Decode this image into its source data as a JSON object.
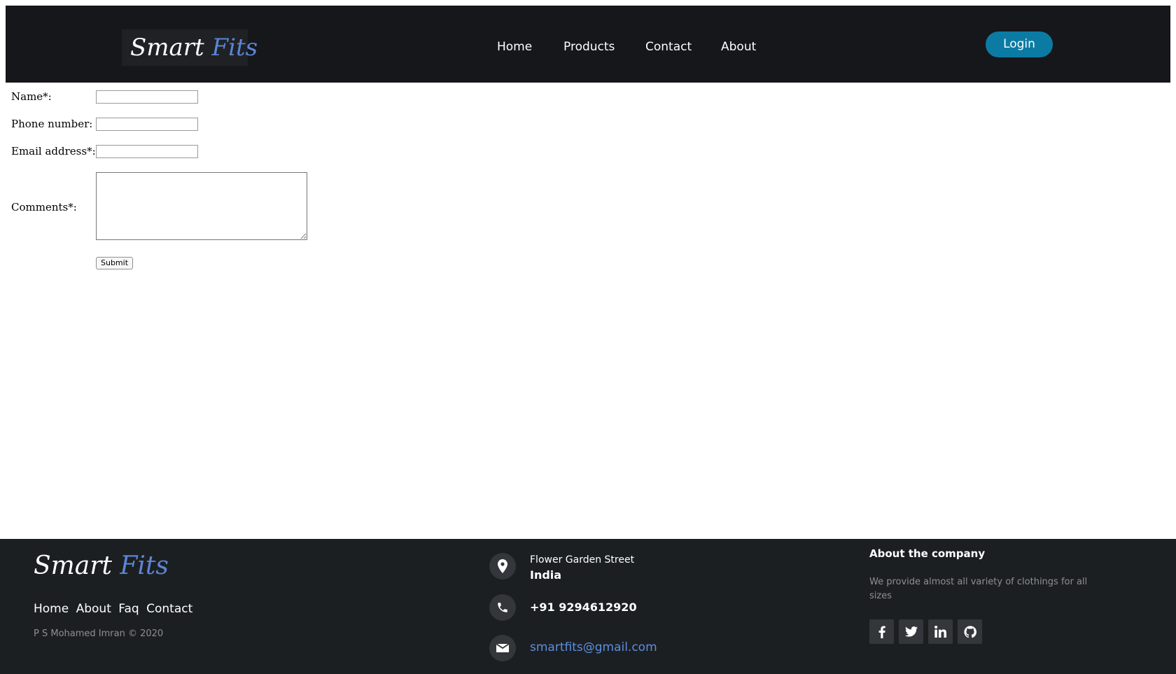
{
  "header": {
    "logo_word1": "Smart",
    "logo_word2": "Fits",
    "nav": [
      "Home",
      "Products",
      "Contact",
      "About"
    ],
    "login_label": "Login"
  },
  "form": {
    "name_label": "Name*:",
    "phone_label": "Phone number:",
    "email_label": "Email address*:",
    "comments_label": "Comments*:",
    "submit_label": "Submit"
  },
  "footer": {
    "logo_word1": "Smart",
    "logo_word2": "Fits",
    "links": [
      "Home",
      "About",
      "Faq",
      "Contact"
    ],
    "copyright": "P S Mohamed Imran © 2020",
    "address_street": "Flower Garden Street",
    "address_country": "India",
    "phone": "+91 9294612920",
    "email": "smartfits@gmail.com",
    "about_title": "About the company",
    "about_text": "We provide almost all variety of clothings for all sizes",
    "social_icons": [
      "facebook-icon",
      "twitter-icon",
      "linkedin-icon",
      "github-icon"
    ]
  },
  "colors": {
    "header_bg": "#16171b",
    "footer_bg": "#1c1f22",
    "login_bg": "#0b7ba4",
    "logo_accent": "#5b86d4",
    "email_link": "#5b8fe0"
  }
}
